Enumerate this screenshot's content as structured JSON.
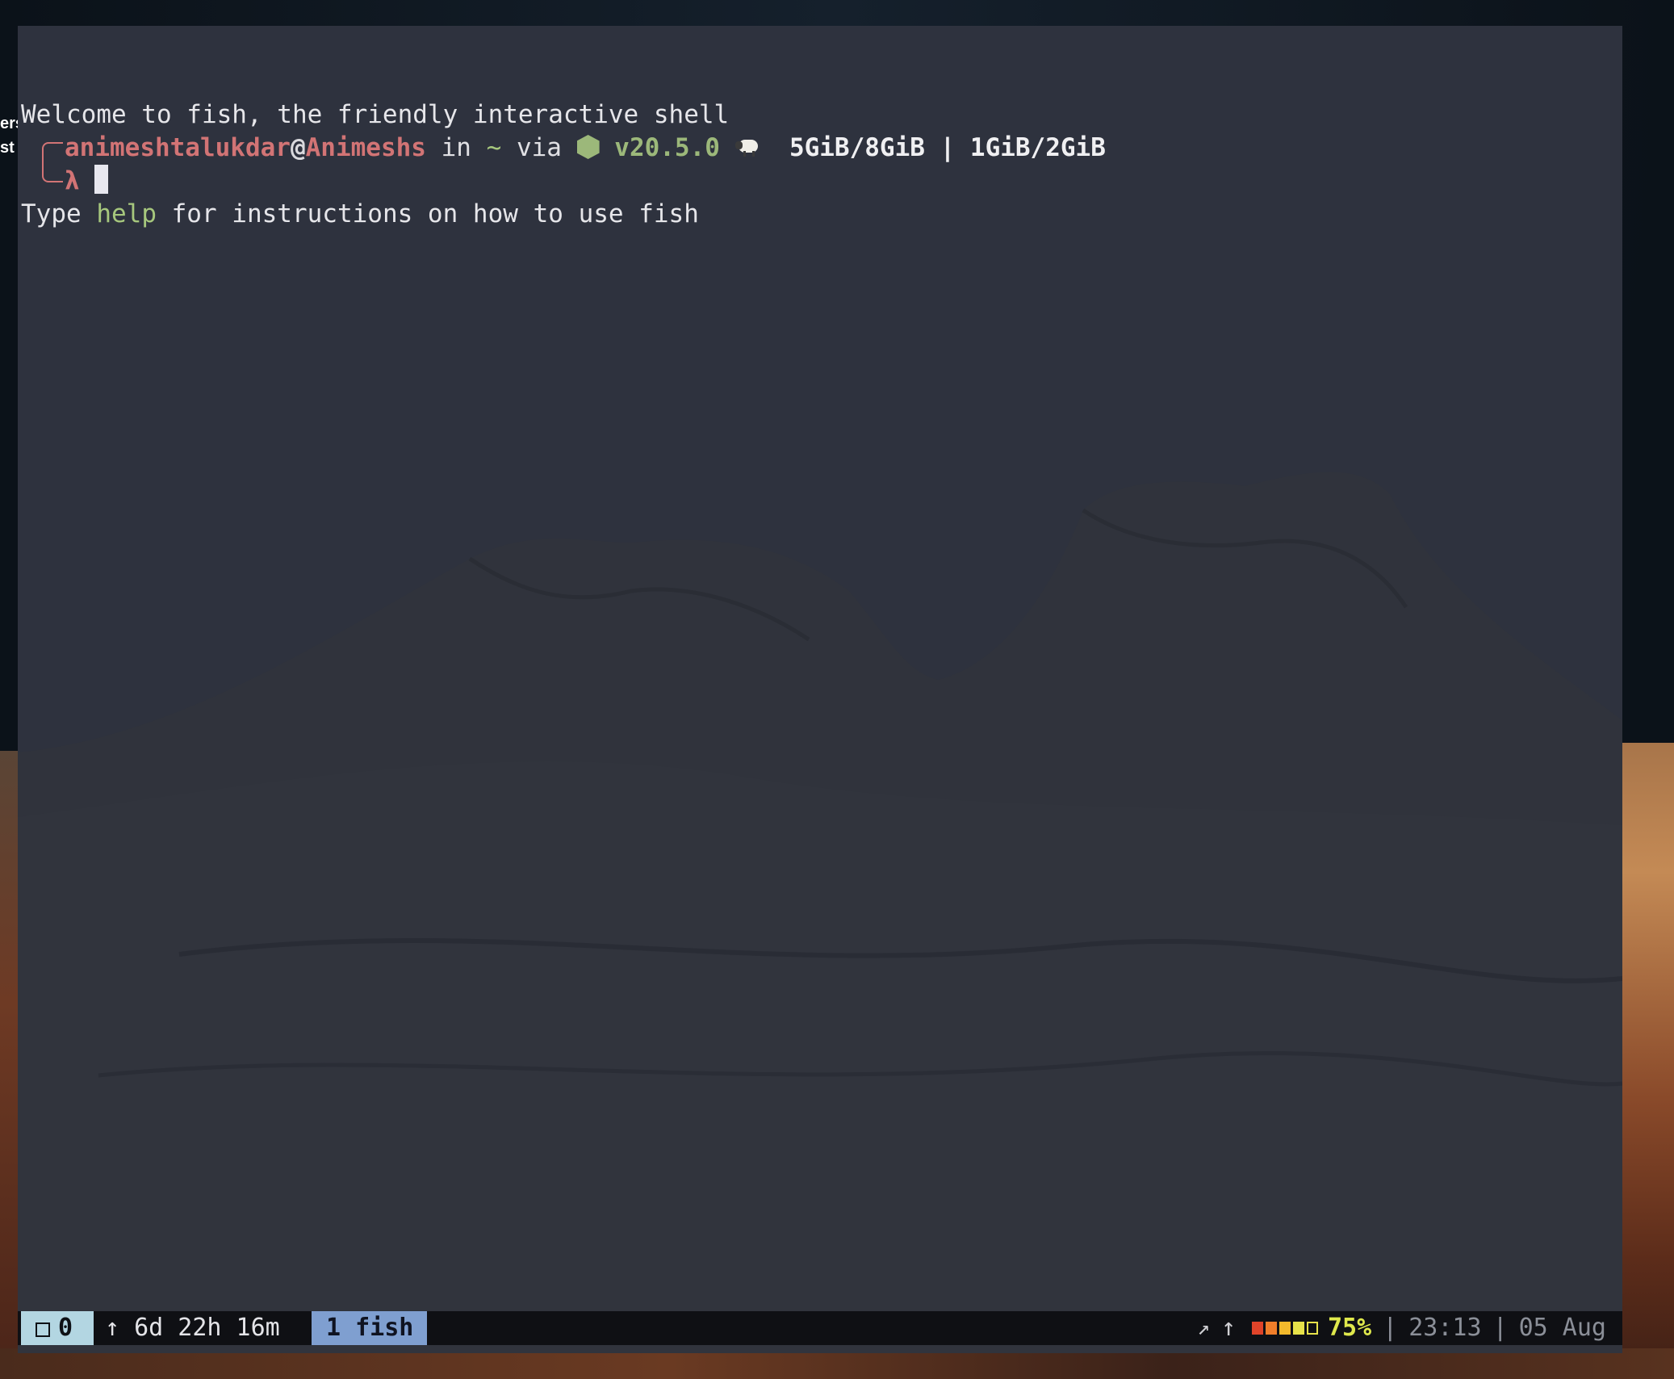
{
  "desktop": {
    "edge_text_1": "ers",
    "edge_text_2": "st"
  },
  "terminal": {
    "welcome_line": "Welcome to fish, the friendly interactive shell",
    "help_line_prefix": "Type ",
    "help_word": "help",
    "help_line_suffix": " for instructions on how to use fish",
    "prompt": {
      "user": "animeshtalukdar",
      "at": "@",
      "host": "Animeshs",
      "in": " in ",
      "dir": "~",
      "via": " via ",
      "node_icon": "hexagon-node-icon",
      "node_version": "v20.5.0",
      "mem_icon": "sheep-icon",
      "memory": "5GiB/8GiB | 1GiB/2GiB",
      "symbol": "λ"
    }
  },
  "statusbar": {
    "session_icon": "square-icon",
    "session_index": "0",
    "uptime": "↑ 6d 22h 16m",
    "window": "1 fish",
    "net_up_icon": "↗",
    "up_arrow": "↑",
    "battery_level": 0.75,
    "battery_percent": "75%",
    "sep": "|",
    "time": "23:13",
    "date": "05 Aug",
    "colors": {
      "session_bg": "#b3d6e2",
      "window_bg": "#7f9fd0",
      "battery_text": "#dfe84c"
    }
  }
}
